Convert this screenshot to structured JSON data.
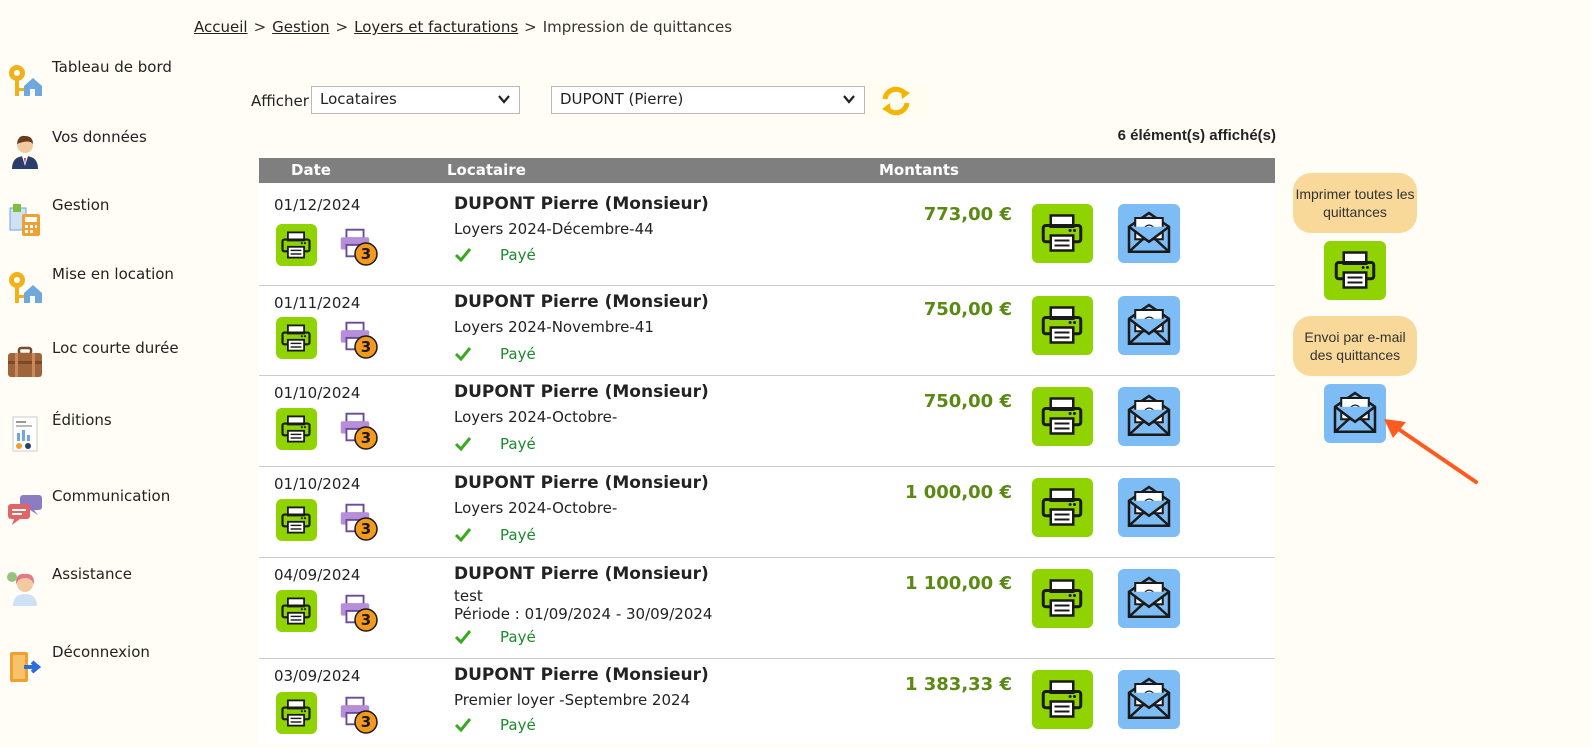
{
  "breadcrumb": {
    "home": "Accueil",
    "management": "Gestion",
    "rents": "Loyers et facturations",
    "current": "Impression de quittances",
    "separator": ">"
  },
  "sidebar": {
    "items": [
      {
        "label": "Tableau de bord",
        "icon": "key-house-icon"
      },
      {
        "label": "Vos données",
        "icon": "user-icon"
      },
      {
        "label": "Gestion",
        "icon": "calculator-icon"
      },
      {
        "label": "Mise en location",
        "icon": "key-house-icon"
      },
      {
        "label": "Loc courte durée",
        "icon": "suitcase-icon"
      },
      {
        "label": "Éditions",
        "icon": "report-icon"
      },
      {
        "label": "Communication",
        "icon": "chat-bubbles-icon"
      },
      {
        "label": "Assistance",
        "icon": "support-agent-icon"
      },
      {
        "label": "Déconnexion",
        "icon": "logout-icon"
      }
    ]
  },
  "filters": {
    "label": "Afficher",
    "display_type": "Locataires",
    "tenant": "DUPONT (Pierre)"
  },
  "count_text": "6 élément(s) affiché(s)",
  "table": {
    "headers": {
      "date": "Date",
      "tenant": "Locataire",
      "amounts": "Montants"
    },
    "badge_count": "3",
    "rows": [
      {
        "date": "01/12/2024",
        "tenant": "DUPONT Pierre (Monsieur)",
        "desc1": "Loyers 2024-Décembre-44",
        "desc2": "",
        "status": "Payé",
        "amount": "773,00 €"
      },
      {
        "date": "01/11/2024",
        "tenant": "DUPONT Pierre (Monsieur)",
        "desc1": "Loyers 2024-Novembre-41",
        "desc2": "",
        "status": "Payé",
        "amount": "750,00 €"
      },
      {
        "date": "01/10/2024",
        "tenant": "DUPONT Pierre (Monsieur)",
        "desc1": "Loyers 2024-Octobre-",
        "desc2": "",
        "status": "Payé",
        "amount": "750,00 €"
      },
      {
        "date": "01/10/2024",
        "tenant": "DUPONT Pierre (Monsieur)",
        "desc1": "Loyers 2024-Octobre-",
        "desc2": "",
        "status": "Payé",
        "amount": "1 000,00 €"
      },
      {
        "date": "04/09/2024",
        "tenant": "DUPONT Pierre (Monsieur)",
        "desc1": "test",
        "desc2": "Période : 01/09/2024 - 30/09/2024",
        "status": "Payé",
        "amount": "1 100,00 €"
      },
      {
        "date": "03/09/2024",
        "tenant": "DUPONT Pierre (Monsieur)",
        "desc1": "Premier loyer -Septembre 2024",
        "desc2": "",
        "status": "Payé",
        "amount": "1 383,33 €"
      }
    ]
  },
  "side_actions": {
    "print_all": "Imprimer toutes les quittances",
    "email_all": "Envoi par e-mail des quittances"
  },
  "colors": {
    "print_green": "#8fd400",
    "mail_blue": "#7dbcf5",
    "pill": "#f8d99a",
    "amount_green": "#5a8a14",
    "paid_green": "#1a8a2a",
    "arrow": "#ff5a1f"
  }
}
